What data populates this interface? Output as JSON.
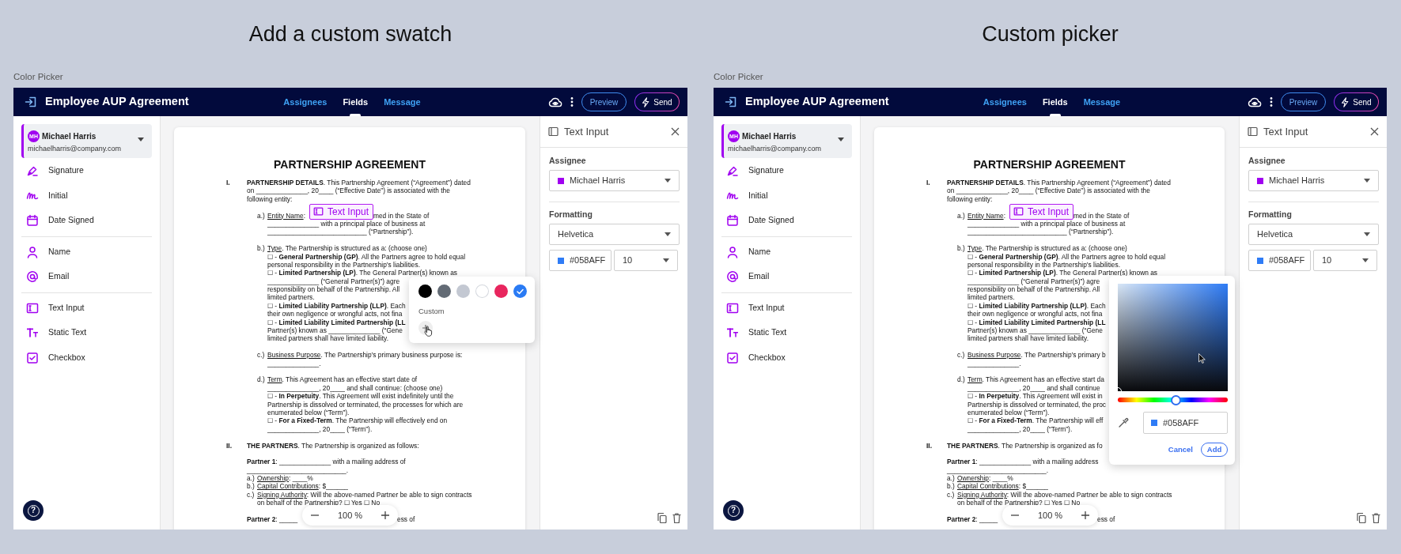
{
  "panels": [
    {
      "heading": "Add a custom swatch",
      "caption": "Color Picker",
      "app": {
        "title": "Employee AUP Agreement",
        "tabs": [
          {
            "label": "Assignees",
            "selected": false
          },
          {
            "label": "Fields",
            "selected": true
          },
          {
            "label": "Message",
            "selected": false
          }
        ],
        "buttons": [
          {
            "label": "Preview",
            "kind": "outline"
          },
          {
            "label": "Send",
            "kind": "send"
          }
        ],
        "assignee": {
          "initials": "MH",
          "name": "Michael Harris",
          "email": "michaelharris@company.com"
        },
        "field_groups": [
          [
            {
              "kind": "signature",
              "label": "Signature"
            },
            {
              "kind": "initial",
              "label": "Initial"
            },
            {
              "kind": "date",
              "label": "Date Signed"
            }
          ],
          [
            {
              "kind": "name",
              "label": "Name"
            },
            {
              "kind": "email",
              "label": "Email"
            }
          ],
          [
            {
              "kind": "text_input",
              "label": "Text Input"
            },
            {
              "kind": "static_text",
              "label": "Static Text"
            },
            {
              "kind": "checkbox",
              "label": "Checkbox"
            }
          ]
        ],
        "help": "?",
        "document": {
          "title": "PARTNERSHIP AGREEMENT",
          "lines": [
            {
              "kind": "section",
              "label": "I.",
              "text": "**PARTNERSHIP DETAILS**. This Partnership Agreement (“Agreement”) dated"
            },
            {
              "kind": "body",
              "text": "on ______________, 20____ (“Effective Date”) is associated with the"
            },
            {
              "kind": "body",
              "text": "following entity:"
            },
            {
              "kind": "item",
              "label": "a.)",
              "term": "Entity Name",
              "text": ":",
              "chip": "Text Input",
              "after": "med in the State of"
            },
            {
              "kind": "sub",
              "text": "______________ with a principal place of business at"
            },
            {
              "kind": "sub",
              "text": "___________________________ (“Partnership”)."
            },
            {
              "kind": "item",
              "label": "b.)",
              "term": "Type",
              "text": ". The Partnership is structured as a: (choose one)"
            },
            {
              "kind": "sub",
              "text": "☐ - **General Partnership (GP)**. All the Partners agree to hold equal"
            },
            {
              "kind": "sub",
              "text": "personal responsibility in the Partnership’s liabilities."
            },
            {
              "kind": "sub",
              "text": "☐ - **Limited Partnership (LP)**. The General Partner(s) known as"
            },
            {
              "kind": "sub",
              "text": "______________ (“General Partner(s)”) agre"
            },
            {
              "kind": "sub",
              "text": "responsibility on behalf of the Partnership. All"
            },
            {
              "kind": "sub",
              "text": "limited partners."
            },
            {
              "kind": "sub",
              "text": "☐ - **Limited Liability Partnership (LLP)**. Each"
            },
            {
              "kind": "sub",
              "text": "their own negligence or wrongful acts, not fina"
            },
            {
              "kind": "sub",
              "text": "☐ - **Limited Liability Limited Partnership (LL**"
            },
            {
              "kind": "sub",
              "text": "Partner(s) known as ______________ (“Gene"
            },
            {
              "kind": "sub",
              "text": "limited partners shall have limited liability."
            },
            {
              "kind": "item",
              "label": "c.)",
              "term": "Business Purpose",
              "text": ". The Partnership’s primary business purpose is:"
            },
            {
              "kind": "sub",
              "text": "______________."
            },
            {
              "kind": "item",
              "label": "d.)",
              "term": "Term",
              "text": ". This Agreement has an effective start date of"
            },
            {
              "kind": "sub",
              "text": "______________, 20____ and shall continue: (choose one)"
            },
            {
              "kind": "sub",
              "text": "☐ - **In Perpetuity**. This Agreement will exist indefinitely until the"
            },
            {
              "kind": "sub",
              "text": "Partnership is dissolved or terminated, the processes for which are"
            },
            {
              "kind": "sub",
              "text": "enumerated below (“Term”)."
            },
            {
              "kind": "sub",
              "text": "☐ - **For a Fixed-Term**. The Partnership will effectively end on"
            },
            {
              "kind": "sub",
              "text": "______________, 20____ (“Term”)."
            },
            {
              "kind": "section",
              "label": "II.",
              "text": "**THE PARTNERS**. The Partnership is organized as follows:"
            },
            {
              "kind": "partner",
              "text": "**Partner 1**: ______________ with a mailing address of"
            },
            {
              "kind": "body",
              "text": "___________________________."
            },
            {
              "kind": "clause",
              "label": "a.)",
              "term": "Ownership",
              "text": ": ____%"
            },
            {
              "kind": "clause",
              "label": "b.)",
              "term": "Capital Contributions",
              "text": ": $______"
            },
            {
              "kind": "clause",
              "label": "c.)",
              "term": "Signing Authority",
              "text": ": Will the above-named Partner be able to sign contracts"
            },
            {
              "kind": "clausecont",
              "text": "on behalf of the Partnership? ☐ Yes ☐ No"
            },
            {
              "kind": "partner",
              "text": "**Partner 2**: _____",
              "after": "ess of"
            }
          ]
        },
        "zoom": "100 %",
        "properties": {
          "title": "Text Input",
          "assignee_label": "Assignee",
          "assignee": {
            "name": "Michael Harris",
            "color": "#a000f0"
          },
          "formatting_label": "Formatting",
          "font": "Helvetica",
          "text_color": {
            "value": "#058AFF",
            "color": "#2f7cf6"
          },
          "size": "10"
        }
      },
      "popover": {
        "kind": "swatches",
        "swatches": [
          {
            "color": "#000000",
            "selected": false
          },
          {
            "color": "#636b75",
            "selected": false
          },
          {
            "color": "#c3c8d2",
            "selected": false
          },
          {
            "color": "#ffffff",
            "selected": false
          },
          {
            "color": "#e8265e",
            "selected": false
          },
          {
            "color": "#2a7bf4",
            "selected": true
          }
        ],
        "custom_label": "Custom"
      }
    },
    {
      "heading": "Custom picker",
      "caption": "Color Picker",
      "app": {
        "title": "Employee AUP Agreement",
        "tabs": [
          {
            "label": "Assignees",
            "selected": false
          },
          {
            "label": "Fields",
            "selected": true
          },
          {
            "label": "Message",
            "selected": false
          }
        ],
        "buttons": [
          {
            "label": "Preview",
            "kind": "outline"
          },
          {
            "label": "Send",
            "kind": "send"
          }
        ],
        "assignee": {
          "initials": "MH",
          "name": "Michael Harris",
          "email": "michaelharris@company.com"
        },
        "field_groups": [
          [
            {
              "kind": "signature",
              "label": "Signature"
            },
            {
              "kind": "initial",
              "label": "Initial"
            },
            {
              "kind": "date",
              "label": "Date Signed"
            }
          ],
          [
            {
              "kind": "name",
              "label": "Name"
            },
            {
              "kind": "email",
              "label": "Email"
            }
          ],
          [
            {
              "kind": "text_input",
              "label": "Text Input"
            },
            {
              "kind": "static_text",
              "label": "Static Text"
            },
            {
              "kind": "checkbox",
              "label": "Checkbox"
            }
          ]
        ],
        "help": "?",
        "document": {
          "title": "PARTNERSHIP AGREEMENT",
          "lines": [
            {
              "kind": "section",
              "label": "I.",
              "text": "**PARTNERSHIP DETAILS**. This Partnership Agreement (“Agreement”) dated"
            },
            {
              "kind": "body",
              "text": "on ______________, 20____ (“Effective Date”) is associated with the"
            },
            {
              "kind": "body",
              "text": "following entity:"
            },
            {
              "kind": "item",
              "label": "a.)",
              "term": "Entity Name",
              "text": ":",
              "chip": "Text Input",
              "after": "med in the State of"
            },
            {
              "kind": "sub",
              "text": "______________ with a principal place of business at"
            },
            {
              "kind": "sub",
              "text": "___________________________ (“Partnership”)."
            },
            {
              "kind": "item",
              "label": "b.)",
              "term": "Type",
              "text": ". The Partnership is structured as a: (choose one)"
            },
            {
              "kind": "sub",
              "text": "☐ - **General Partnership (GP)**. All the Partners agree to hold equal"
            },
            {
              "kind": "sub",
              "text": "personal responsibility in the Partnership’s liabilities."
            },
            {
              "kind": "sub",
              "text": "☐ - **Limited Partnership (LP)**. The General Partner(s) known as"
            },
            {
              "kind": "sub",
              "text": "______________ (“General Partner(s)”) agre"
            },
            {
              "kind": "sub",
              "text": "responsibility on behalf of the Partnership. All"
            },
            {
              "kind": "sub",
              "text": "limited partners."
            },
            {
              "kind": "sub",
              "text": "☐ - **Limited Liability Partnership (LLP)**. Each"
            },
            {
              "kind": "sub",
              "text": "their own negligence or wrongful acts, not fina"
            },
            {
              "kind": "sub",
              "text": "☐ - **Limited Liability Limited Partnership (LL**"
            },
            {
              "kind": "sub",
              "text": "Partner(s) known as ______________ (“Gene"
            },
            {
              "kind": "sub",
              "text": "limited partners shall have limited liability."
            },
            {
              "kind": "item",
              "label": "c.)",
              "term": "Business Purpose",
              "text": ". The Partnership’s primary b"
            },
            {
              "kind": "sub",
              "text": "______________."
            },
            {
              "kind": "item",
              "label": "d.)",
              "term": "Term",
              "text": ". This Agreement has an effective start da"
            },
            {
              "kind": "sub",
              "text": "______________, 20____ and shall continue"
            },
            {
              "kind": "sub",
              "text": "☐ - **In Perpetuity**. This Agreement will exist in"
            },
            {
              "kind": "sub",
              "text": "Partnership is dissolved or terminated, the proc"
            },
            {
              "kind": "sub",
              "text": "enumerated below (“Term”)."
            },
            {
              "kind": "sub",
              "text": "☐ - **For a Fixed-Term**. The Partnership will eff"
            },
            {
              "kind": "sub",
              "text": "______________, 20____ (“Term”)."
            },
            {
              "kind": "section",
              "label": "II.",
              "text": "**THE PARTNERS**. The Partnership is organized as fo"
            },
            {
              "kind": "partner",
              "text": "**Partner 1**: ______________ with a mailing address"
            },
            {
              "kind": "body",
              "text": "___________________________."
            },
            {
              "kind": "clause",
              "label": "a.)",
              "term": "Ownership",
              "text": ": ____%"
            },
            {
              "kind": "clause",
              "label": "b.)",
              "term": "Capital Contributions",
              "text": ": $______"
            },
            {
              "kind": "clause",
              "label": "c.)",
              "term": "Signing Authority",
              "text": ": Will the above-named Partner be able to sign contracts"
            },
            {
              "kind": "clausecont",
              "text": "on behalf of the Partnership? ☐ Yes ☐ No"
            },
            {
              "kind": "partner",
              "text": "**Partner 2**: _____",
              "after": "ess of"
            }
          ]
        },
        "zoom": "100 %",
        "properties": {
          "title": "Text Input",
          "assignee_label": "Assignee",
          "assignee": {
            "name": "Michael Harris",
            "color": "#a000f0"
          },
          "formatting_label": "Formatting",
          "font": "Helvetica",
          "text_color": {
            "value": "#058AFF",
            "color": "#2f7cf6"
          },
          "size": "10"
        }
      },
      "popover": {
        "kind": "picker",
        "hue_slider": {
          "level": 0.53
        },
        "hex": {
          "value": "#058AFF",
          "color": "#2f7cf6"
        },
        "cancel": "Cancel",
        "add": "Add"
      }
    }
  ]
}
